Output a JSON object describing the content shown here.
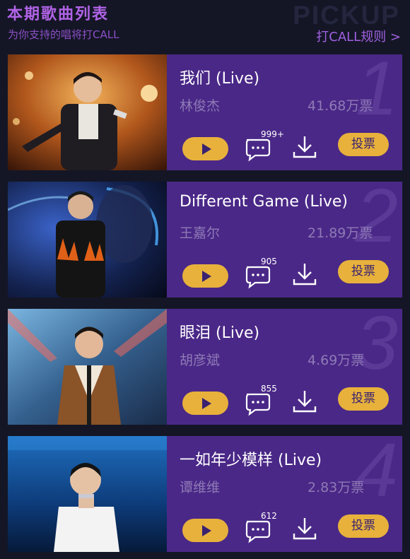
{
  "header": {
    "title": "本期歌曲列表",
    "subtitle": "为你支持的唱将打CALL",
    "watermark": "PICKUP",
    "rules_link": "打CALL规则 >"
  },
  "songs": [
    {
      "rank": "1",
      "title": "我们 (Live)",
      "singer": "林俊杰",
      "votes": "41.68万票",
      "comments": "999+",
      "vote_label": "投票"
    },
    {
      "rank": "2",
      "title": "Different Game (Live)",
      "singer": "王嘉尔",
      "votes": "21.89万票",
      "comments": "905",
      "vote_label": "投票"
    },
    {
      "rank": "3",
      "title": "眼泪 (Live)",
      "singer": "胡彦斌",
      "votes": "4.69万票",
      "comments": "855",
      "vote_label": "投票"
    },
    {
      "rank": "4",
      "title": "一如年少模样 (Live)",
      "singer": "谭维维",
      "votes": "2.83万票",
      "comments": "612",
      "vote_label": "投票"
    }
  ],
  "colors": {
    "background": "#141626",
    "card": "#4a2887",
    "accent_button": "#e7b13c",
    "title_purple": "#b163e6"
  },
  "icons": [
    "play-icon",
    "comment-icon",
    "download-icon"
  ]
}
